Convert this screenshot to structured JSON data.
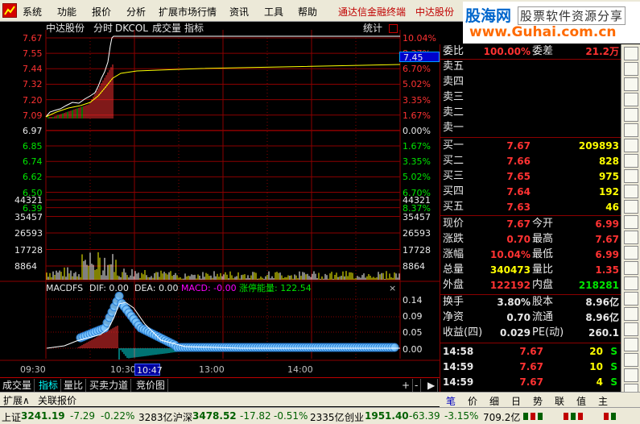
{
  "menu": {
    "items": [
      "系统",
      "功能",
      "报价",
      "分析",
      "扩展市场行情",
      "资讯",
      "工具",
      "帮助"
    ],
    "broker": "通达信金融终端",
    "stock": "中达股份"
  },
  "logo": {
    "brand": "股海网",
    "tagline": "股票软件资源分享",
    "url": "www.Guhai.com.cn"
  },
  "chart_header": {
    "stock": "中达股份",
    "mode": "分时",
    "indicator": "DKCOL",
    "volume": "成交量",
    "index_label": "指标",
    "stats": "统计"
  },
  "price_axis_left": [
    "7.67",
    "7.55",
    "7.44",
    "7.32",
    "7.20",
    "7.09",
    "6.97",
    "6.85",
    "6.74",
    "6.62",
    "6.50",
    "6.39"
  ],
  "pct_axis_right": [
    "10.04%",
    "8.37%",
    "6.70%",
    "5.02%",
    "3.35%",
    "1.67%",
    "0.00%",
    "1.67%",
    "3.35%",
    "5.02%",
    "6.70%",
    "8.37%"
  ],
  "current_price_tag": "7.45",
  "volume_axis": [
    "44321",
    "35457",
    "26593",
    "17728",
    "8864"
  ],
  "macd": {
    "name": "MACDFS",
    "dif_label": "DIF: 0.00",
    "dea_label": "DEA: 0.00",
    "macd_label": "MACD: -0.00",
    "limit_label": "涨停能量: 122.54",
    "axis": [
      "0.14",
      "0.09",
      "0.05",
      "0.00"
    ],
    "close": "×"
  },
  "time_axis": [
    "09:30",
    "10:30",
    "13:00",
    "14:00"
  ],
  "cursor_time": "10:47",
  "bottom_tabs": [
    "成交量",
    "指标",
    "量比",
    "买卖力道",
    "竞价图"
  ],
  "bottom_ctrl": [
    "+",
    "-",
    "▶"
  ],
  "status1": [
    "扩展∧",
    "关联报价"
  ],
  "order_book": {
    "weibi_label": "委比",
    "weibi_value": "100.00%",
    "weicha_label": "委差",
    "weicha_value": "21.2万",
    "sell": [
      {
        "label": "卖五",
        "price": "",
        "vol": ""
      },
      {
        "label": "卖四",
        "price": "",
        "vol": ""
      },
      {
        "label": "卖三",
        "price": "",
        "vol": ""
      },
      {
        "label": "卖二",
        "price": "",
        "vol": ""
      },
      {
        "label": "卖一",
        "price": "",
        "vol": ""
      }
    ],
    "buy": [
      {
        "label": "买一",
        "price": "7.67",
        "vol": "209893"
      },
      {
        "label": "买二",
        "price": "7.66",
        "vol": "828"
      },
      {
        "label": "买三",
        "price": "7.65",
        "vol": "975"
      },
      {
        "label": "买四",
        "price": "7.64",
        "vol": "192"
      },
      {
        "label": "买五",
        "price": "7.63",
        "vol": "46"
      }
    ]
  },
  "quote": [
    {
      "l1": "现价",
      "v1": "7.67",
      "l2": "今开",
      "v2": "6.99"
    },
    {
      "l1": "涨跌",
      "v1": "0.70",
      "l2": "最高",
      "v2": "7.67"
    },
    {
      "l1": "涨幅",
      "v1": "10.04%",
      "l2": "最低",
      "v2": "6.99"
    },
    {
      "l1": "总量",
      "v1": "340473",
      "l2": "量比",
      "v2": "1.35"
    },
    {
      "l1": "外盘",
      "v1": "122192",
      "l2": "内盘",
      "v2": "218281"
    }
  ],
  "fundamentals": [
    {
      "l1": "换手",
      "v1": "3.80%",
      "l2": "股本",
      "v2": "8.96亿"
    },
    {
      "l1": "净资",
      "v1": "0.70",
      "l2": "流通",
      "v2": "8.96亿"
    },
    {
      "l1": "收益(四)",
      "v1": "0.029",
      "l2": "PE(动)",
      "v2": "260.1"
    }
  ],
  "ticks": [
    {
      "time": "14:58",
      "price": "7.67",
      "vol": "20",
      "side": "S"
    },
    {
      "time": "14:59",
      "price": "7.67",
      "vol": "10",
      "side": "S"
    },
    {
      "time": "14:59",
      "price": "7.67",
      "vol": "4",
      "side": "S"
    }
  ],
  "right_tabs": [
    "笔",
    "价",
    "细",
    "日",
    "势",
    "联",
    "值",
    "主"
  ],
  "index_bar": {
    "sh_label": "上证",
    "sh_val": "3241.19",
    "sh_chg": "-7.29",
    "sh_pct": "-0.22%",
    "sh_amt": "3283亿",
    "hs_label": "沪深",
    "hs_val": "3478.52",
    "hs_chg": "-17.82",
    "hs_pct": "-0.51%",
    "hs_amt": "2335亿",
    "cy_label": "创业",
    "cy_val": "1951.40",
    "cy_chg": "-63.39",
    "cy_pct": "-3.15%",
    "cy_amt": "709.2亿"
  },
  "colors": {
    "up": "#ff3232",
    "down": "#00e600",
    "grid": "#8b0000",
    "price_line": "#ffffff",
    "avg_line": "#ffff00"
  }
}
